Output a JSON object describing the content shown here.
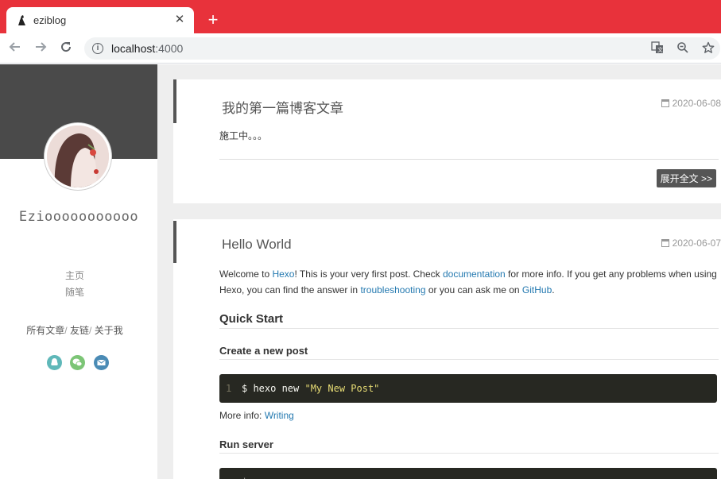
{
  "browser": {
    "tab_title": "eziblog",
    "close_glyph": "✕",
    "new_tab_glyph": "+",
    "url_host": "localhost",
    "url_port": ":4000",
    "icons": [
      "back-arrow-icon",
      "forward-arrow-icon",
      "reload-icon",
      "info-icon",
      "translate-icon",
      "zoom-out-icon",
      "bookmark-star-icon"
    ],
    "accent_color": "#e8323b"
  },
  "sidebar": {
    "blog_name": "Eziooooooooooo",
    "menu": [
      {
        "label": "主页"
      },
      {
        "label": "随笔"
      }
    ],
    "links": [
      {
        "label": "所有文章"
      },
      {
        "label": "友链"
      },
      {
        "label": "关于我"
      }
    ],
    "link_separator": "/",
    "social": [
      {
        "name": "qq-icon",
        "color": "#5fb8b9"
      },
      {
        "name": "wechat-icon",
        "color": "#7cc576"
      },
      {
        "name": "email-icon",
        "color": "#4a8bb5"
      }
    ]
  },
  "posts": [
    {
      "title": "我的第一篇博客文章",
      "date": "2020-06-08",
      "excerpt": "施工中。。。",
      "more_label": "展开全文 >>"
    },
    {
      "title": "Hello World",
      "date": "2020-06-07",
      "intro": {
        "t1": "Welcome to ",
        "link_hexo": "Hexo",
        "t2": "! This is your very first post. Check ",
        "link_docs": "documentation",
        "t3": " for more info. If you get any problems when using Hexo, you can find the answer in ",
        "link_trouble": "troubleshooting",
        "t4": " or you can ask me on ",
        "link_github": "GitHub",
        "t5": "."
      },
      "quick_start": "Quick Start",
      "create_heading": "Create a new post",
      "code1": {
        "line": "1",
        "cmd": "$ hexo new ",
        "str": "\"My New Post\""
      },
      "more_info_label": "More info: ",
      "more_info_link": "Writing",
      "run_heading": "Run server",
      "code2_prefix": "$"
    }
  ]
}
